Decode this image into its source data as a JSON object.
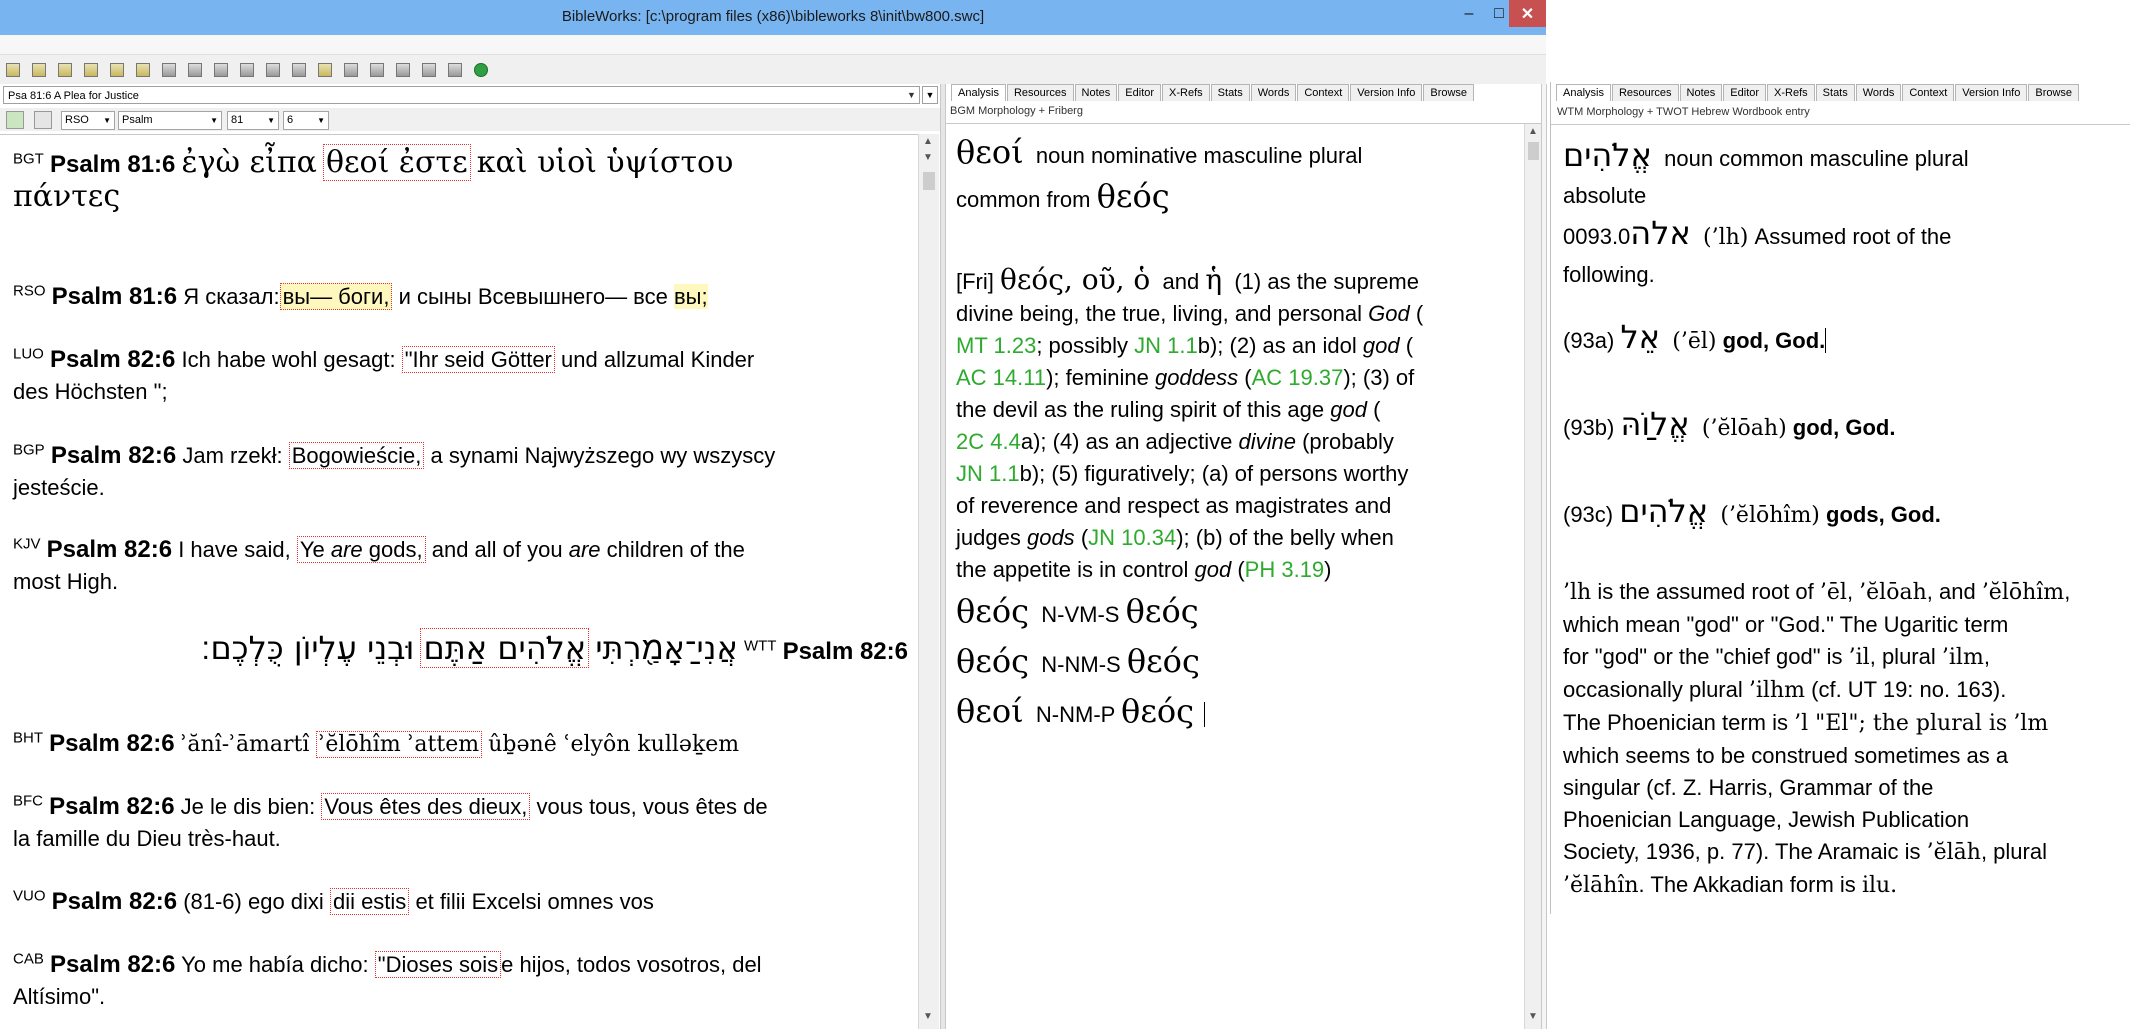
{
  "window": {
    "title": "BibleWorks: [c:\\program files (x86)\\bibleworks 8\\init\\bw800.swc]",
    "min_label": "–",
    "max_label": "□",
    "close_label": "✕"
  },
  "browse": {
    "reference": "Psa 81:6 A Plea for Justice",
    "selectors": [
      "RSO",
      "Psalm",
      "81",
      "6"
    ],
    "verses": {
      "bgt": {
        "ver": "BGT",
        "ref": "Psalm 81:6",
        "pre": "ἐγὼ εἶπα",
        "hit": "θεοί ἐστε",
        "post": "καὶ υἱοὶ ὑψίστου",
        "line2": "πάντες"
      },
      "rso": {
        "ver": "RSO",
        "ref": "Psalm 81:6",
        "pre": "Я сказал:",
        "hit": "вы— боги,",
        "post": "и сыны Всевышнего— все",
        "end": "вы;"
      },
      "luo": {
        "ver": "LUO",
        "ref": "Psalm 82:6",
        "pre": "Ich habe wohl gesagt:",
        "hit": "\"Ihr seid Götter",
        "post": "und allzumal Kinder",
        "line2": "des Höchsten \";"
      },
      "bgp": {
        "ver": "BGP",
        "ref": "Psalm 82:6",
        "pre": "Jam rzekł:",
        "hit": "Bogowieście,",
        "post": "a synami Najwyższego wy wszyscy",
        "line2": "jesteście."
      },
      "kjv": {
        "ver": "KJV",
        "ref": "Psalm 82:6",
        "pre": "I have said,",
        "hit_a": "Ye",
        "hit_it": "are",
        "hit_b": "gods,",
        "post_a": "and all of you",
        "post_it": "are",
        "post_b": "children of the",
        "line2": "most High."
      },
      "wtt": {
        "ver": "WTT",
        "ref": "Psalm 82:6",
        "pre": "אֲנִי־ַאָמַ֖רְתִּי",
        "hit": "אֱלֹהִים אַתֶּם",
        "post": "וּבְנֵי עֶלְיוֹן כֻּלְכֶם׃"
      },
      "bht": {
        "ver": "BHT",
        "ref": "Psalm 82:6",
        "pre": "ʾănî-ʾāmartî",
        "hit": "ʾĕlōhîm ʾattem",
        "post": "ûḇənê ʿelyôn kulləḵem"
      },
      "bfc": {
        "ver": "BFC",
        "ref": "Psalm 82:6",
        "pre": "Je le dis bien:",
        "hit": "Vous êtes des dieux,",
        "post": "vous tous, vous êtes de",
        "line2": "la famille du Dieu très-haut."
      },
      "vuo": {
        "ver": "VUO",
        "ref": "Psalm 82:6",
        "pre": "(81-6) ego dixi",
        "hit": "dii estis",
        "post": "et filii Excelsi omnes vos"
      },
      "cab": {
        "ver": "CAB",
        "ref": "Psalm 82:6",
        "pre": "Yo me había dicho:",
        "hit": "\"Dioses sois",
        "post": "e hijos, todos vosotros, del",
        "line2": "Altísimo\"."
      }
    }
  },
  "analysis1": {
    "tabs": [
      "Analysis",
      "Resources",
      "Notes",
      "Editor",
      "X-Refs",
      "Stats",
      "Words",
      "Context",
      "Version Info",
      "Browse"
    ],
    "subtitle": "BGM Morphology + Friberg",
    "head_word": "θεοί",
    "head_desc": "noun nominative masculine plural",
    "head_line2": "common from",
    "head_lemma": "θεός",
    "fri": {
      "tag": "[Fri]",
      "lemma": "θεός",
      "gen": ", οῦ, ὁ",
      "and": "and",
      "fem": "ἡ",
      "t1": "(1) as the supreme",
      "t2": "divine being, the true, living, and personal",
      "god1": "God",
      "t3": "(",
      "mt": "MT 1.23",
      "t4": "; possibly",
      "jn1": "JN 1.1",
      "t5": "b); (2) as an idol",
      "god2": "god",
      "t6": "(",
      "ac1": "AC 14.11",
      "t7": "); feminine",
      "goddess": "goddess",
      "t8": "(",
      "ac2": "AC 19.37",
      "t9": "); (3) of",
      "t10": "the devil as the ruling spirit of this age",
      "god3": "god",
      "t11": "(",
      "co": "2C 4.4",
      "t12": "a); (4) as an adjective",
      "divine": "divine",
      "t13": "(probably",
      "jn2": "JN 1.1",
      "t14": "b); (5) figuratively; (a) of persons worthy",
      "t15": "of reverence and respect as magistrates and",
      "t16": "judges",
      "gods": "gods",
      "t17": "(",
      "jn3": "JN 10.34",
      "t18": "); (b) of the belly when",
      "t19": "the appetite is in control",
      "god4": "god",
      "t20": "(",
      "ph": "PH 3.19",
      "t21": ")"
    },
    "parses": [
      {
        "form": "θεός",
        "code": "N-VM-S",
        "lemma": "θεός"
      },
      {
        "form": "θεός",
        "code": "N-NM-S",
        "lemma": "θεός"
      },
      {
        "form": "θεοί",
        "code": "N-NM-P",
        "lemma": "θεός"
      }
    ]
  },
  "analysis2": {
    "tabs": [
      "Analysis",
      "Resources",
      "Notes",
      "Editor",
      "X-Refs",
      "Stats",
      "Words",
      "Context",
      "Version Info",
      "Browse"
    ],
    "subtitle": "WTM Morphology + TWOT Hebrew Wordbook entry",
    "head_word": "אֱלֹהִים",
    "head_desc": "noun common masculine plural",
    "head_line2": "absolute",
    "num": "0093.0",
    "root": "אלה",
    "root_translit": "(’lh)",
    "root_desc": "Assumed root of the",
    "root_desc2": "following.",
    "entries": [
      {
        "num": "(93a)",
        "heb": "אֵל",
        "translit": "(’ēl)",
        "gloss": "god, God."
      },
      {
        "num": "(93b)",
        "heb": "אֱלוַֹהּ",
        "translit": "(’ĕlōah)",
        "gloss": "god, God."
      },
      {
        "num": "(93c)",
        "heb": "אֱלֹהִים",
        "translit": "(’ĕlōhîm)",
        "gloss": "gods, God."
      }
    ],
    "para": [
      {
        "t": "’lh",
        "s": true
      },
      {
        "t": " is the assumed root of "
      },
      {
        "t": "’ēl",
        "s": true
      },
      {
        "t": ", "
      },
      {
        "t": "’ĕlōah",
        "s": true
      },
      {
        "t": ", and "
      },
      {
        "t": "’ĕlōhîm",
        "s": true
      },
      {
        "t": ","
      }
    ],
    "lines": [
      "which mean \"god\" or \"God.\" The Ugaritic term",
      "for \"god\" or the \"chief god\" is",
      "occasionally plural",
      "The Phoenician term is",
      "which seems to be construed sometimes as a",
      "singular (cf. Z. Harris, Grammar of the",
      "Phoenician Language, Jewish Publication",
      "Society, 1936, p. 77). The Aramaic is",
      "The Akkadian form is"
    ],
    "il": "’il",
    "plural": ", plural",
    "ilm": "’ilm",
    "ilhm": "’ilhm",
    "ut": "(cf. UT 19: no. 163).",
    "l_el": "’l \"El\"; the plural is",
    "lm": "’lm",
    "elah": "’ĕlāh",
    "elahin": "’ĕlāhîn",
    "plural2": ", plural",
    "ilu": "ilu."
  }
}
